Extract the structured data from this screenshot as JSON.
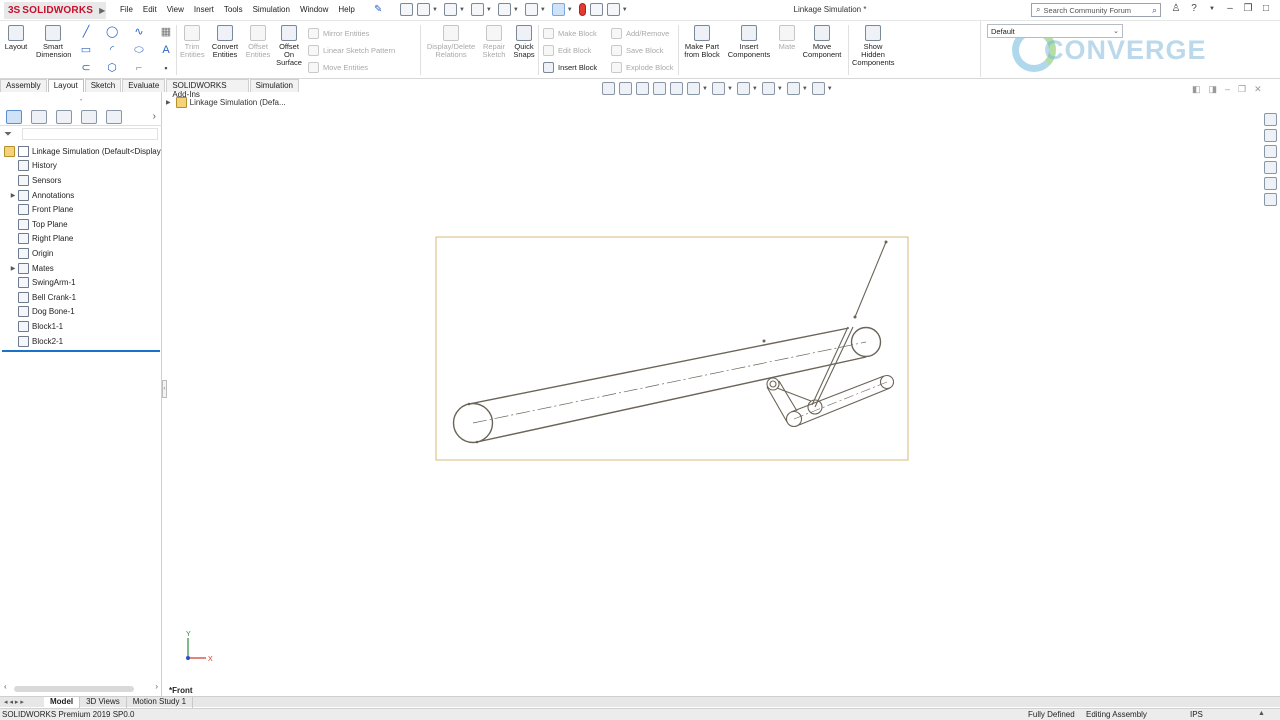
{
  "app": {
    "logo_ds": "3S",
    "logo_name": "SOLIDWORKS",
    "document_title": "Linkage Simulation *"
  },
  "menu": [
    "File",
    "Edit",
    "View",
    "Insert",
    "Tools",
    "Simulation",
    "Window",
    "Help"
  ],
  "search": {
    "placeholder": "Search Community Forum"
  },
  "ribbon": {
    "layout": "Layout",
    "smart_dimension": "Smart Dimension",
    "trim_entities": "Trim Entities",
    "convert_entities": "Convert Entities",
    "offset_entities": "Offset Entities",
    "offset_on_surface": "Offset On Surface",
    "mirror_entities": "Mirror Entities",
    "linear_sketch_pattern": "Linear Sketch Pattern",
    "move_entities": "Move Entities",
    "display_delete_relations": "Display/Delete Relations",
    "repair_sketch": "Repair Sketch",
    "quick_snaps": "Quick Snaps",
    "make_block": "Make Block",
    "edit_block": "Edit Block",
    "insert_block": "Insert Block",
    "add_remove": "Add/Remove",
    "save_block": "Save Block",
    "explode_block": "Explode Block",
    "make_part_from_block": "Make Part from Block",
    "insert_components": "Insert Components",
    "mate": "Mate",
    "move_component": "Move Component",
    "show_hidden_components": "Show Hidden Components",
    "configuration": "Default",
    "brand": "CONVERGE"
  },
  "tabs": [
    {
      "label": "Assembly",
      "active": false
    },
    {
      "label": "Layout",
      "active": true
    },
    {
      "label": "Sketch",
      "active": false
    },
    {
      "label": "Evaluate",
      "active": false
    },
    {
      "label": "SOLIDWORKS Add-Ins",
      "active": false
    },
    {
      "label": "Simulation",
      "active": false
    }
  ],
  "tree": {
    "root": "Linkage Simulation  (Default<Display",
    "items": [
      {
        "label": "History",
        "expand": false
      },
      {
        "label": "Sensors",
        "expand": false
      },
      {
        "label": "Annotations",
        "expand": true
      },
      {
        "label": "Front Plane",
        "expand": false
      },
      {
        "label": "Top Plane",
        "expand": false
      },
      {
        "label": "Right Plane",
        "expand": false
      },
      {
        "label": "Origin",
        "expand": false
      },
      {
        "label": "Mates",
        "expand": true
      },
      {
        "label": "SwingArm-1",
        "expand": false
      },
      {
        "label": "Bell Crank-1",
        "expand": false
      },
      {
        "label": "Dog Bone-1",
        "expand": false
      },
      {
        "label": "Block1-1",
        "expand": false
      },
      {
        "label": "Block2-1",
        "expand": false
      }
    ]
  },
  "graphics": {
    "breadcrumb": "Linkage Simulation  (Defa...",
    "view_name": "*Front",
    "triad_x": "X",
    "triad_y": "Y"
  },
  "bottom_tabs": [
    {
      "label": "Model",
      "active": true
    },
    {
      "label": "3D Views",
      "active": false
    },
    {
      "label": "Motion Study 1",
      "active": false
    }
  ],
  "status": {
    "product": "SOLIDWORKS Premium 2019 SP0.0",
    "definition": "Fully Defined",
    "mode": "Editing Assembly",
    "units": "IPS"
  },
  "colors": {
    "sketch_line": "#6b6458",
    "layout_border": "#d9b97a",
    "selection_blue": "#1a73c9",
    "brand_red": "#c8102e"
  }
}
